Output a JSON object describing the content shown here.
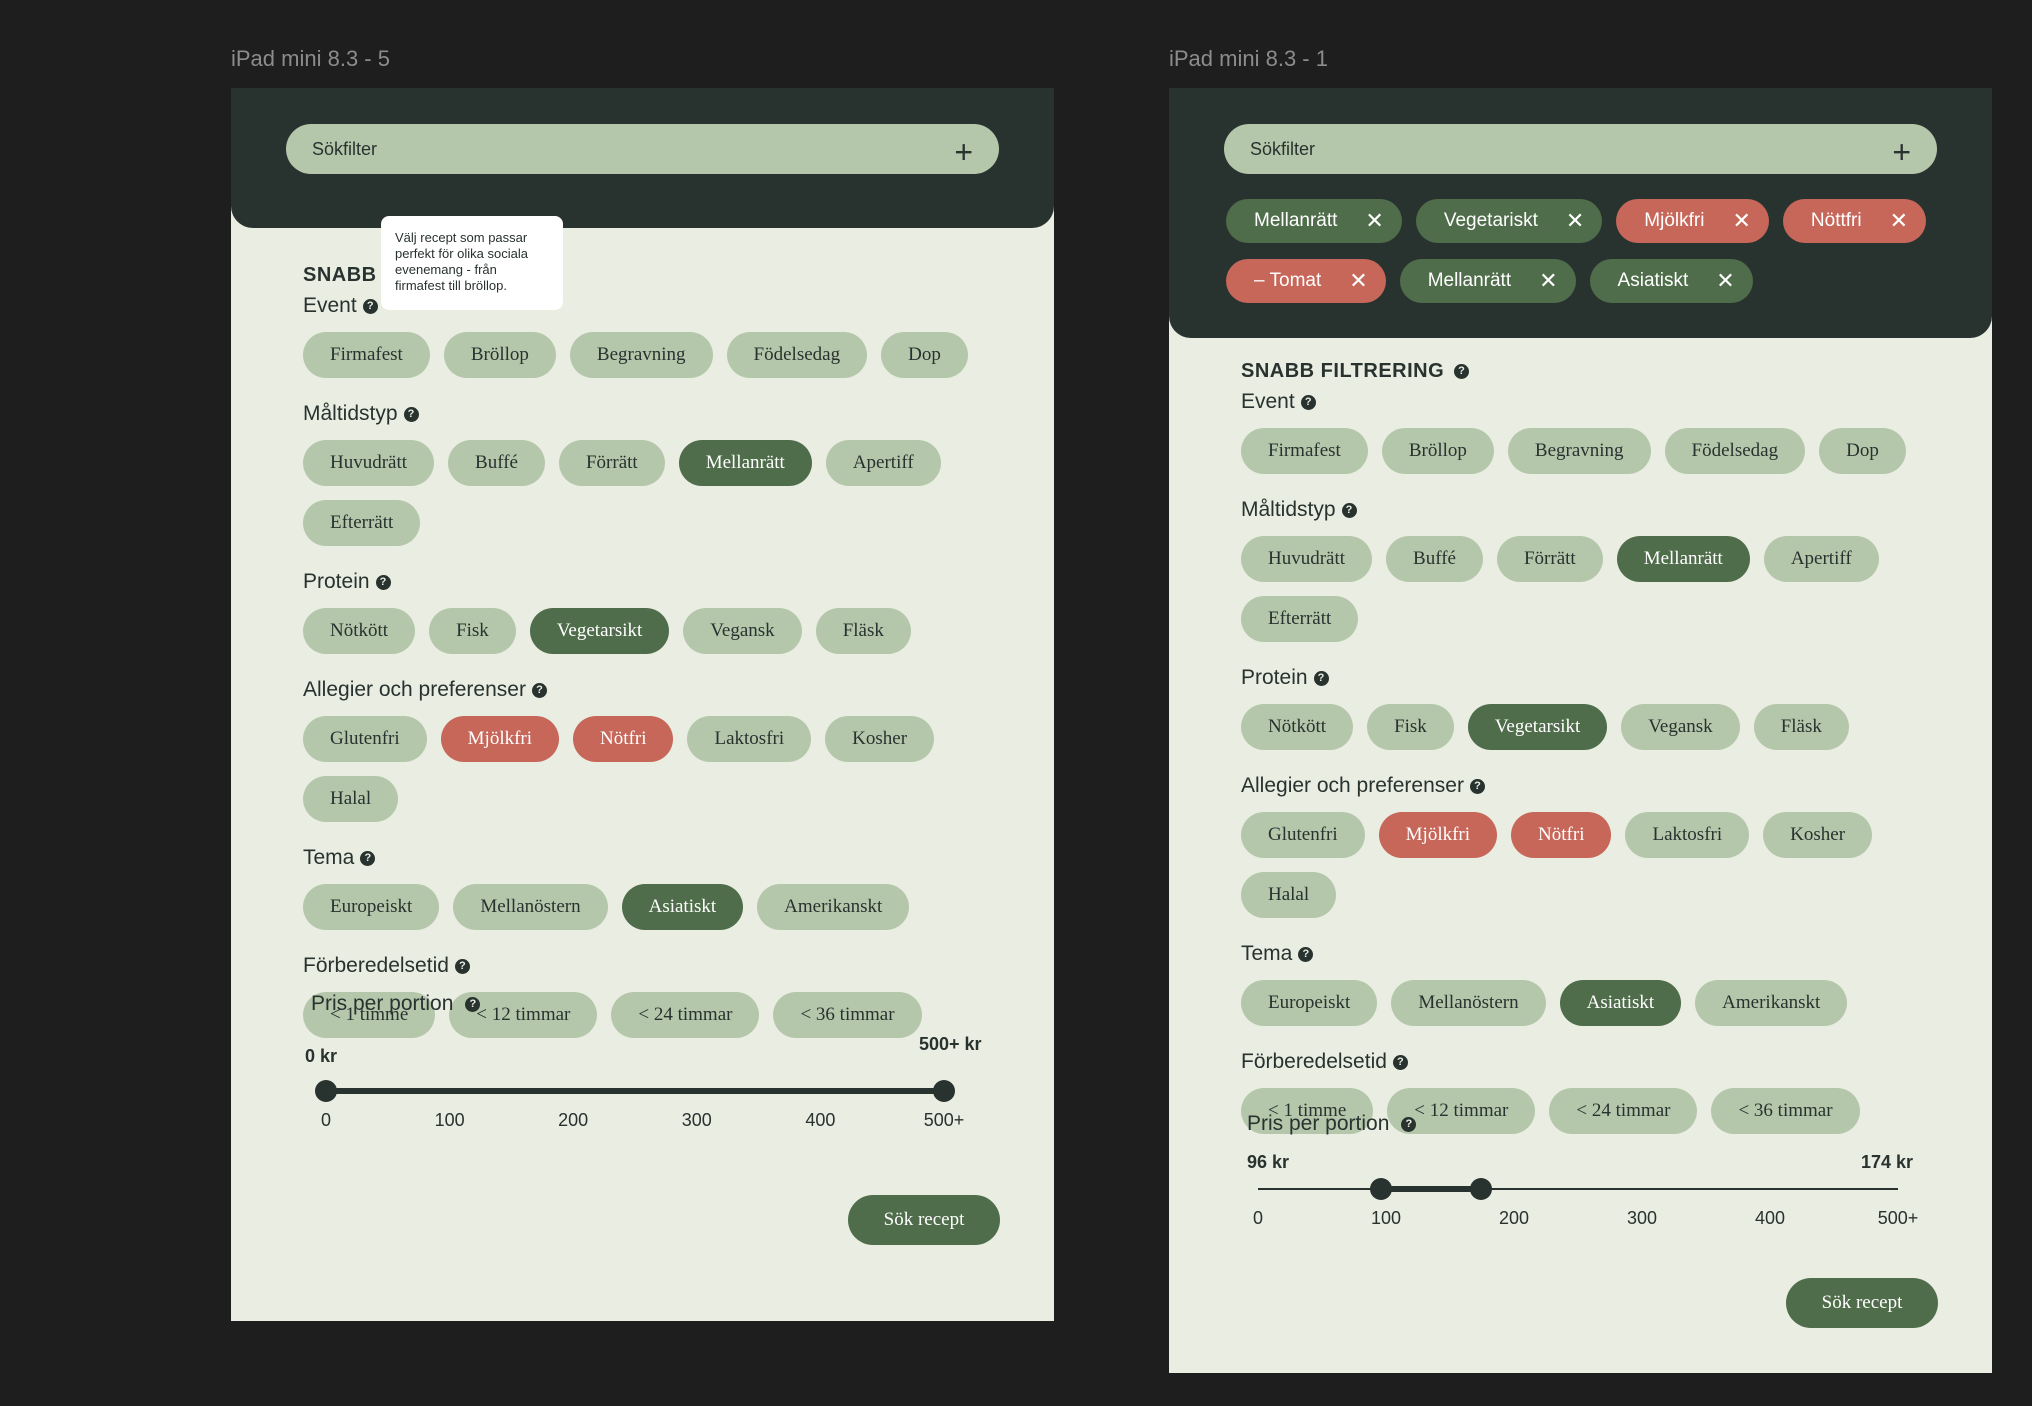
{
  "frames": {
    "left": {
      "label": "iPad mini 8.3 - 5"
    },
    "right": {
      "label": "iPad mini 8.3 - 1"
    }
  },
  "search": {
    "label": "Sökfilter",
    "add_icon": "+"
  },
  "tooltip": {
    "text": "Välj recept som passar perfekt för olika sociala evenemang - från firmafest till bröllop."
  },
  "quick_filter": {
    "title": "SNABB FILTRERING",
    "title_partial": "SNABB F"
  },
  "help_icon": "?",
  "active_filters": [
    {
      "label": "Mellanrätt",
      "kind": "green"
    },
    {
      "label": "Vegetariskt",
      "kind": "green"
    },
    {
      "label": "Mjölkfri",
      "kind": "red"
    },
    {
      "label": "Nöttfri",
      "kind": "red"
    },
    {
      "label": "– Tomat",
      "kind": "red"
    },
    {
      "label": "Mellanrätt",
      "kind": "green"
    },
    {
      "label": "Asiatiskt",
      "kind": "green"
    }
  ],
  "remove_icon": "✕",
  "sections": {
    "event": {
      "label": "Event",
      "options": [
        "Firmafest",
        "Bröllop",
        "Begravning",
        "Födelsedag",
        "Dop"
      ]
    },
    "meal_type": {
      "label": "Måltidstyp",
      "options": [
        "Huvudrätt",
        "Buffé",
        "Förrätt",
        "Mellanrätt",
        "Apertiff",
        "Efterrätt"
      ],
      "selected": [
        "Mellanrätt"
      ]
    },
    "protein": {
      "label": "Protein",
      "options": [
        "Nötkött",
        "Fisk",
        "Vegetarsikt",
        "Vegansk",
        "Fläsk"
      ],
      "selected": [
        "Vegetarsikt"
      ]
    },
    "allergies": {
      "label": "Allegier och preferenser",
      "options": [
        "Glutenfri",
        "Mjölkfri",
        "Nötfri",
        "Laktosfri",
        "Kosher",
        "Halal"
      ],
      "selected": [
        "Mjölkfri",
        "Nötfri"
      ]
    },
    "theme": {
      "label": "Tema",
      "options": [
        "Europeiskt",
        "Mellanöstern",
        "Asiatiskt",
        "Amerikanskt"
      ],
      "selected": [
        "Asiatiskt"
      ]
    },
    "prep_time": {
      "label": "Förberedelsetid",
      "options": [
        "< 1 timme",
        "< 12 timmar",
        "< 24 timmar",
        "< 36 timmar"
      ]
    }
  },
  "price": {
    "label": "Pris per portion",
    "ticks": [
      "0",
      "100",
      "200",
      "300",
      "400",
      "500+"
    ],
    "left_frame": {
      "min_label": "0 kr",
      "max_label": "500+ kr",
      "min_value": 0,
      "max_value": 500
    },
    "right_frame": {
      "min_label": "96 kr",
      "max_label": "174 kr",
      "min_value": 96,
      "max_value": 174
    }
  },
  "submit": {
    "label": "Sök recept"
  }
}
